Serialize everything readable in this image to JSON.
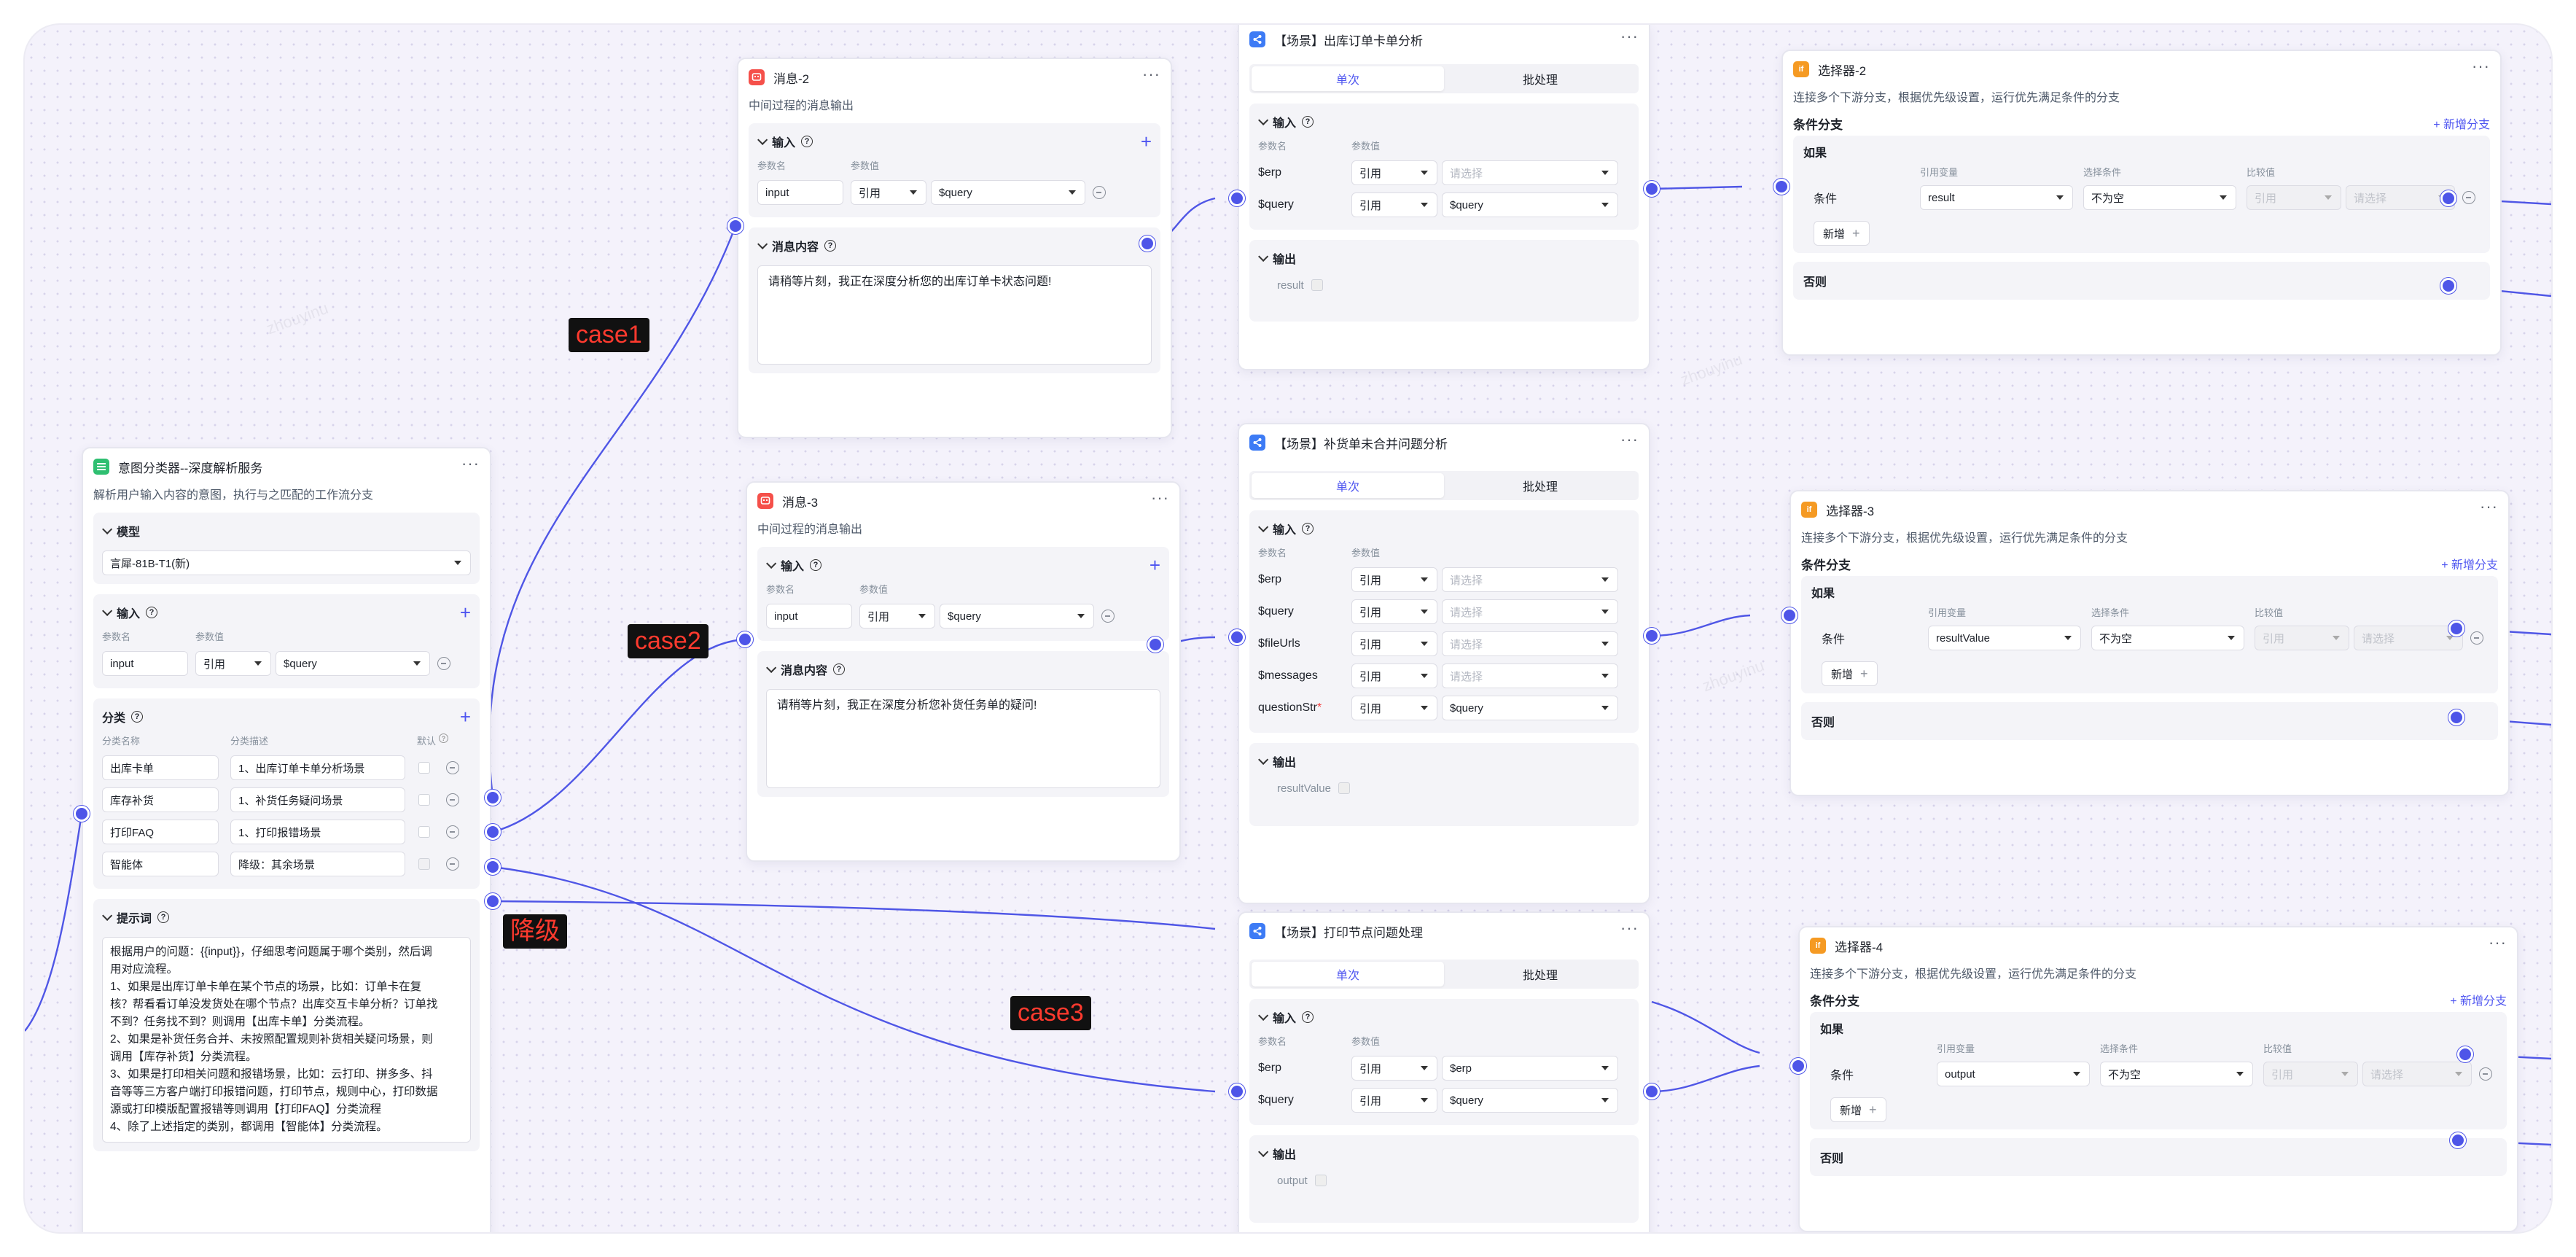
{
  "intent": {
    "title": "意图分类器--深度解析服务",
    "desc": "解析用户输入内容的意图，执行与之匹配的工作流分支",
    "model_label": "模型",
    "model_value": "言犀-81B-T1(新)",
    "input_label": "输入",
    "param_name_label": "参数名",
    "param_value_label": "参数值",
    "input_name": "input",
    "input_type": "引用",
    "input_value": "$query",
    "class_label": "分类",
    "class_name_label": "分类名称",
    "class_desc_label": "分类描述",
    "default_label": "默认",
    "classes": [
      {
        "name": "出库卡单",
        "desc": "1、出库订单卡单分析场景"
      },
      {
        "name": "库存补货",
        "desc": "1、补货任务疑问场景"
      },
      {
        "name": "打印FAQ",
        "desc": "1、打印报错场景"
      },
      {
        "name": "智能体",
        "desc": "降级：其余场景"
      }
    ],
    "prompt_label": "提示词",
    "prompt_lines": [
      "根据用户的问题：{{input}}，仔细思考问题属于哪个类别，然后调",
      "用对应流程。",
      "1、如果是出库订单卡单在某个节点的场景，比如：订单卡在复",
      "核？帮看看订单没发货处在哪个节点？出库交互卡单分析？订单找",
      "不到？任务找不到？则调用【出库卡单】分类流程。",
      "2、如果是补货任务合并、未按照配置规则补货相关疑问场景，则",
      "调用【库存补货】分类流程。",
      "3、如果是打印相关问题和报错场景，比如：云打印、拼多多、抖",
      "音等等三方客户端打印报错问题，打印节点，规则中心，打印数据",
      "源或打印模版配置报错等则调用【打印FAQ】分类流程",
      "4、除了上述指定的类别，都调用【智能体】分类流程。"
    ]
  },
  "msg2": {
    "title": "消息-2",
    "desc": "中间过程的消息输出",
    "input_label": "输入",
    "param_name_label": "参数名",
    "param_value_label": "参数值",
    "input_name": "input",
    "input_type": "引用",
    "input_value": "$query",
    "content_label": "消息内容",
    "content": "请稍等片刻，我正在深度分析您的出库订单卡状态问题!"
  },
  "msg3": {
    "title": "消息-3",
    "desc": "中间过程的消息输出",
    "input_label": "输入",
    "param_name_label": "参数名",
    "param_value_label": "参数值",
    "input_name": "input",
    "input_type": "引用",
    "input_value": "$query",
    "content_label": "消息内容",
    "content": "请稍等片刻，我正在深度分析您补货任务单的疑问!"
  },
  "scene1": {
    "title": "【场景】出库订单卡单分析",
    "tab_single": "单次",
    "tab_batch": "批处理",
    "input_label": "输入",
    "param_name_label": "参数名",
    "param_value_label": "参数值",
    "rows": [
      {
        "name": "$erp",
        "type": "引用",
        "value": "请选择"
      },
      {
        "name": "$query",
        "type": "引用",
        "value": "$query"
      }
    ],
    "output_label": "输出",
    "output_name": "result"
  },
  "scene2": {
    "title": "【场景】补货单未合并问题分析",
    "tab_single": "单次",
    "tab_batch": "批处理",
    "input_label": "输入",
    "param_name_label": "参数名",
    "param_value_label": "参数值",
    "rows": [
      {
        "name": "$erp",
        "type": "引用",
        "value": "请选择"
      },
      {
        "name": "$query",
        "type": "引用",
        "value": "请选择"
      },
      {
        "name": "$fileUrls",
        "type": "引用",
        "value": "请选择"
      },
      {
        "name": "$messages",
        "type": "引用",
        "value": "请选择"
      },
      {
        "name": "questionStr",
        "required": "*",
        "type": "引用",
        "value": "$query"
      }
    ],
    "output_label": "输出",
    "output_name": "resultValue"
  },
  "scene3": {
    "title": "【场景】打印节点问题处理",
    "tab_single": "单次",
    "tab_batch": "批处理",
    "input_label": "输入",
    "param_name_label": "参数名",
    "param_value_label": "参数值",
    "rows": [
      {
        "name": "$erp",
        "type": "引用",
        "value": "$erp"
      },
      {
        "name": "$query",
        "type": "引用",
        "value": "$query"
      }
    ],
    "output_label": "输出",
    "output_name": "output"
  },
  "sel2": {
    "title": "选择器-2",
    "desc": "连接多个下游分支，根据优先级设置，运行优先满足条件的分支",
    "branch_label": "条件分支",
    "add_branch": "新增分支",
    "if_label": "如果",
    "var_label": "引用变量",
    "cond_label": "选择条件",
    "cmp_label": "比较值",
    "cond_name": "条件",
    "var_value": "result",
    "cond_value": "不为空",
    "cmp_type": "引用",
    "cmp_value": "请选择",
    "add_label": "新增",
    "else_label": "否则"
  },
  "sel3": {
    "title": "选择器-3",
    "desc": "连接多个下游分支，根据优先级设置，运行优先满足条件的分支",
    "branch_label": "条件分支",
    "add_branch": "新增分支",
    "if_label": "如果",
    "var_label": "引用变量",
    "cond_label": "选择条件",
    "cmp_label": "比较值",
    "cond_name": "条件",
    "var_value": "resultValue",
    "cond_value": "不为空",
    "cmp_type": "引用",
    "cmp_value": "请选择",
    "add_label": "新增",
    "else_label": "否则"
  },
  "sel4": {
    "title": "选择器-4",
    "desc": "连接多个下游分支，根据优先级设置，运行优先满足条件的分支",
    "branch_label": "条件分支",
    "add_branch": "新增分支",
    "if_label": "如果",
    "var_label": "引用变量",
    "cond_label": "选择条件",
    "cmp_label": "比较值",
    "cond_name": "条件",
    "var_value": "output",
    "cond_value": "不为空",
    "cmp_type": "引用",
    "cmp_value": "请选择",
    "add_label": "新增",
    "else_label": "否则"
  },
  "labels": {
    "case1": "case1",
    "case2": "case2",
    "case3": "case3",
    "fallback": "降级"
  },
  "icon_names": {
    "intent": "list-icon",
    "message": "message-icon",
    "scene": "share-icon",
    "selector": "if-icon"
  },
  "colors": {
    "accent": "#4e55f0",
    "intent_icon": "#2fbf71",
    "message_icon": "#f5504a",
    "scene_icon": "#3d7bf5",
    "selector_icon": "#f59a23",
    "annotation_bg": "#111111",
    "annotation_text": "#ff3a2e"
  }
}
